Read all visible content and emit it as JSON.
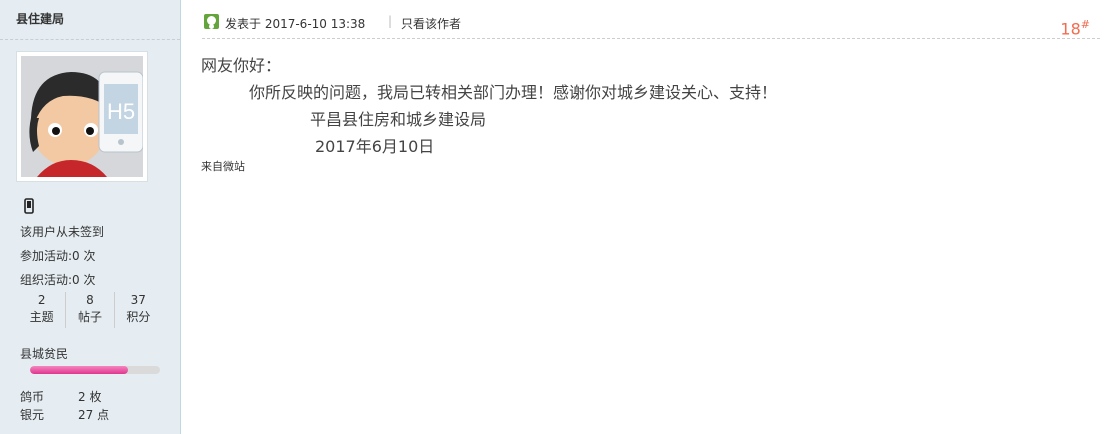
{
  "sidebar": {
    "username": "县住建局",
    "avatar_badge": "H5",
    "checkin_text": "该用户从未签到",
    "activities_joined": "参加活动:0 次",
    "activities_organized": "组织活动:0 次",
    "counters": [
      {
        "value": "2",
        "label": "主题"
      },
      {
        "value": "8",
        "label": "帖子"
      },
      {
        "value": "37",
        "label": "积分"
      }
    ],
    "user_group": "县城贫民",
    "level_progress_fraction": 0.75,
    "currencies": [
      {
        "name": "鸽币",
        "value": "2 枚"
      },
      {
        "name": "银元",
        "value": "27 点"
      }
    ]
  },
  "post": {
    "posted_at": "发表于 2017-6-10 13:38",
    "separator": "|",
    "author_only_label": "只看该作者",
    "floor_number": "18",
    "floor_suffix": "#",
    "content_lines": [
      "网友你好：",
      "你所反映的问题，我局已转相关部门办理！感谢你对城乡建设关心、支持！",
      "平昌县住房和城乡建设局",
      "2017年6月10日"
    ],
    "source": "来自微站"
  },
  "colors": {
    "sidebar_bg": "#e5edf2",
    "floor_accent": "#f26c4f",
    "progress_fill": "#e0358f"
  }
}
